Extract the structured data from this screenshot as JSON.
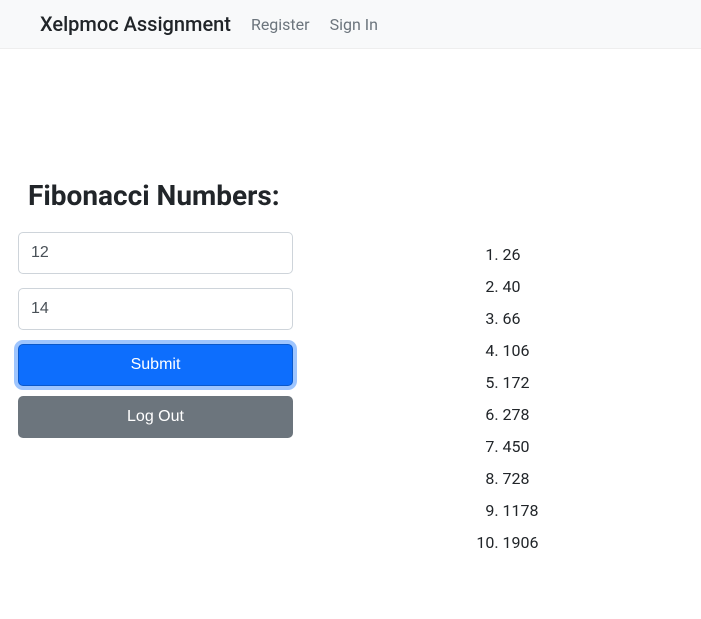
{
  "navbar": {
    "brand": "Xelpmoc Assignment",
    "links": [
      {
        "label": "Register"
      },
      {
        "label": "Sign In"
      }
    ]
  },
  "form": {
    "heading": "Fibonacci Numbers:",
    "input1": "12",
    "input2": "14",
    "submit_label": "Submit",
    "logout_label": "Log Out"
  },
  "results": [
    "26",
    "40",
    "66",
    "106",
    "172",
    "278",
    "450",
    "728",
    "1178",
    "1906"
  ]
}
